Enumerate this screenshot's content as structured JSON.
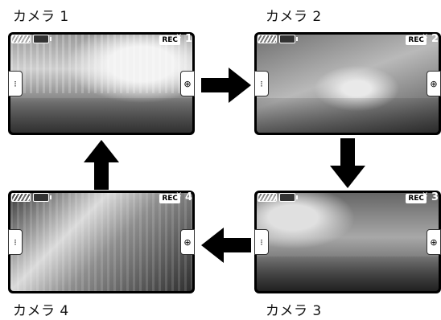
{
  "cameras": [
    {
      "label": "カメラ 1",
      "rec": "REC",
      "number": "1"
    },
    {
      "label": "カメラ 2",
      "rec": "REC",
      "number": "2"
    },
    {
      "label": "カメラ 3",
      "rec": "REC",
      "number": "3"
    },
    {
      "label": "カメラ 4",
      "rec": "REC",
      "number": "4"
    }
  ],
  "icons": {
    "options": "options-dots-icon",
    "zoom": "zoom-in-icon",
    "battery": "battery-icon",
    "sd_card": "sd-card-icon",
    "rec_x": "rec-cancel-icon",
    "arrow": "flow-arrow-icon"
  },
  "colors": {
    "frame": "#000000",
    "arrow": "#000000",
    "background": "#ffffff"
  }
}
